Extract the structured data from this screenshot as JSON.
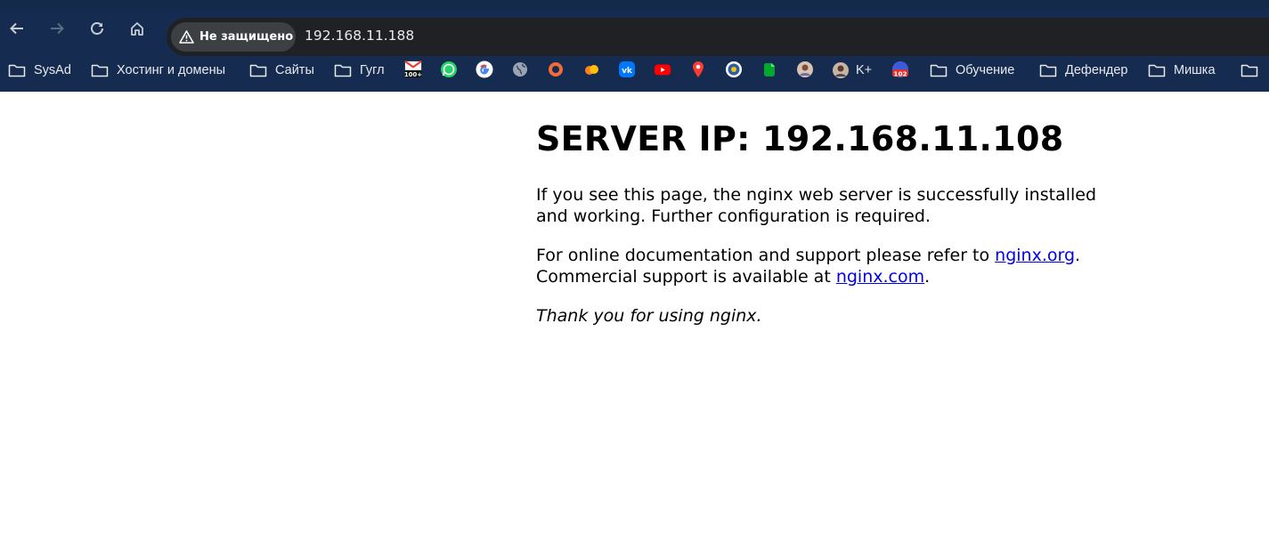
{
  "browser": {
    "security_chip": "Не защищено",
    "url": "192.168.11.188"
  },
  "bookmarks": {
    "sysad": "SysAd",
    "hosting": "Хостинг и домены",
    "sites": "Сайты",
    "google_folder": "Гугл",
    "kplus": "K+",
    "learning": "Обучение",
    "defender": "Дефендер",
    "mishka": "Мишка",
    "icons": [
      "gmail-100-icon",
      "whatsapp-icon",
      "google-icon",
      "globe-icon",
      "circle-app-icon",
      "cloud-icon",
      "vk-icon",
      "youtube-icon",
      "maps-pin-icon",
      "gov-emblem-icon",
      "evernote-icon",
      "avatar-icon",
      "avatar-kplus-icon",
      "badge-102-icon"
    ]
  },
  "page": {
    "heading": "SERVER IP: 192.168.11.108",
    "p1": "If you see this page, the nginx web server is successfully installed and working. Further configuration is required.",
    "p2_before": "For online documentation and support please refer to ",
    "p2_link1": "nginx.org",
    "p2_mid": ".",
    "p2_line2": "Commercial support is available at ",
    "p2_link2": "nginx.com",
    "p2_end": ".",
    "p3": "Thank you for using nginx."
  }
}
